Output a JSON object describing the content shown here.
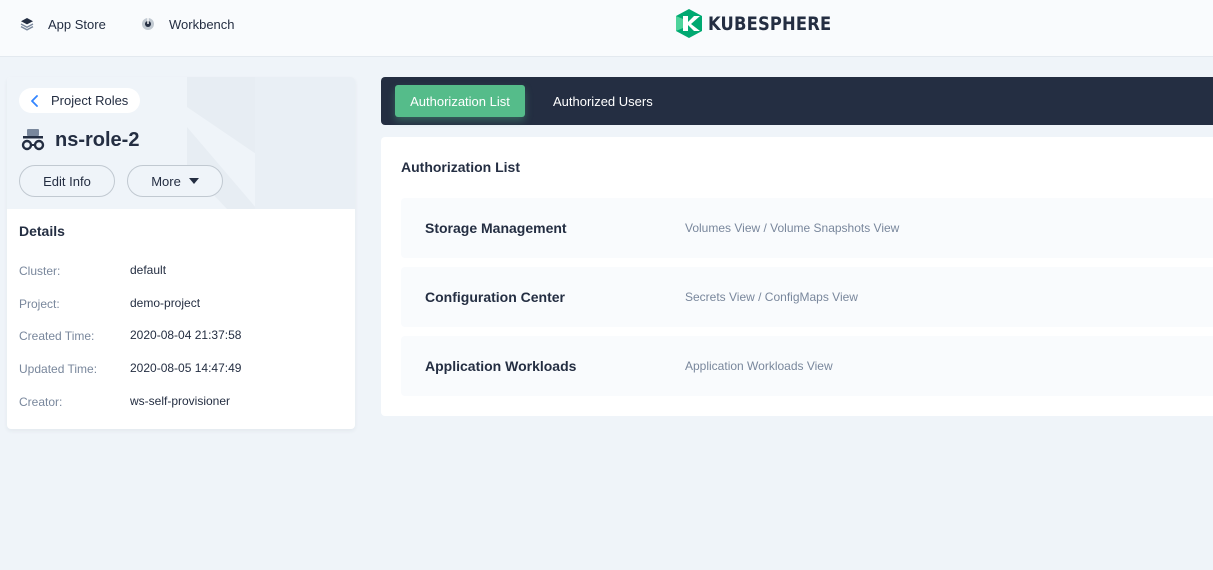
{
  "header": {
    "nav": [
      {
        "label": "App Store",
        "icon": "layers-icon"
      },
      {
        "label": "Workbench",
        "icon": "dashboard-icon"
      }
    ],
    "logo_text": "KUBESPHERE",
    "brand_color": "#00a971"
  },
  "sidebar": {
    "back_label": "Project Roles",
    "role_name": "ns-role-2",
    "role_icon": "role-icon",
    "edit_label": "Edit Info",
    "more_label": "More",
    "details_title": "Details",
    "details": [
      {
        "key": "Cluster:",
        "value": "default"
      },
      {
        "key": "Project:",
        "value": "demo-project"
      },
      {
        "key": "Created Time:",
        "value": "2020-08-04 21:37:58"
      },
      {
        "key": "Updated Time:",
        "value": "2020-08-05 14:47:49"
      },
      {
        "key": "Creator:",
        "value": "ws-self-provisioner"
      }
    ]
  },
  "tabs": [
    {
      "label": "Authorization List",
      "active": true
    },
    {
      "label": "Authorized Users",
      "active": false
    }
  ],
  "main": {
    "title": "Authorization List",
    "rows": [
      {
        "module": "Storage Management",
        "permissions": "Volumes View / Volume Snapshots View"
      },
      {
        "module": "Configuration Center",
        "permissions": "Secrets View / ConfigMaps View"
      },
      {
        "module": "Application Workloads",
        "permissions": "Application Workloads View"
      }
    ]
  },
  "colors": {
    "accent_green": "#55bc8a",
    "dark_nav": "#242e42",
    "background": "#eff4f9"
  }
}
